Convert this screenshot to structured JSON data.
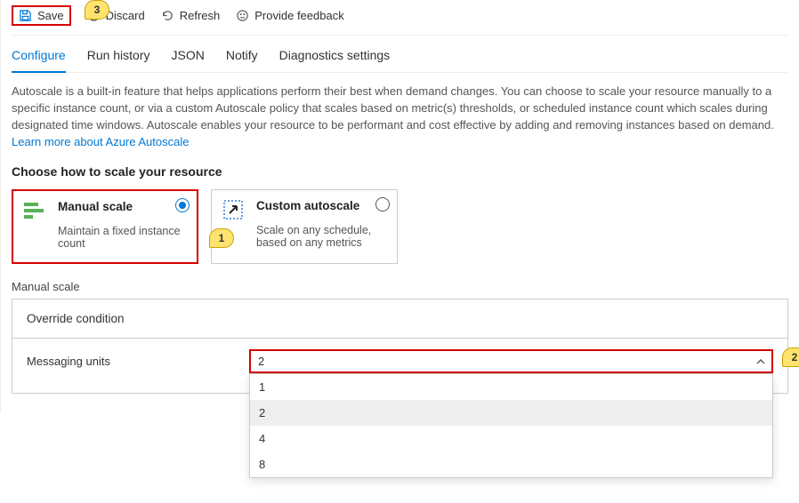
{
  "toolbar": {
    "save": "Save",
    "discard": "Discard",
    "refresh": "Refresh",
    "feedback": "Provide feedback"
  },
  "tabs": {
    "configure": "Configure",
    "run_history": "Run history",
    "json": "JSON",
    "notify": "Notify",
    "diag": "Diagnostics settings"
  },
  "description": {
    "text": "Autoscale is a built-in feature that helps applications perform their best when demand changes. You can choose to scale your resource manually to a specific instance count, or via a custom Autoscale policy that scales based on metric(s) thresholds, or scheduled instance count which scales during designated time windows. Autoscale enables your resource to be performant and cost effective by adding and removing instances based on demand. ",
    "link": "Learn more about Azure Autoscale"
  },
  "choose_title": "Choose how to scale your resource",
  "cards": {
    "manual": {
      "title": "Manual scale",
      "sub": "Maintain a fixed instance count"
    },
    "custom": {
      "title": "Custom autoscale",
      "sub": "Scale on any schedule, based on any metrics"
    }
  },
  "section_label": "Manual scale",
  "panel": {
    "header": "Override condition",
    "field_label": "Messaging units",
    "value": "2",
    "options": [
      "1",
      "2",
      "4",
      "8"
    ]
  },
  "callouts": {
    "c1": "1",
    "c2": "2",
    "c3": "3"
  }
}
